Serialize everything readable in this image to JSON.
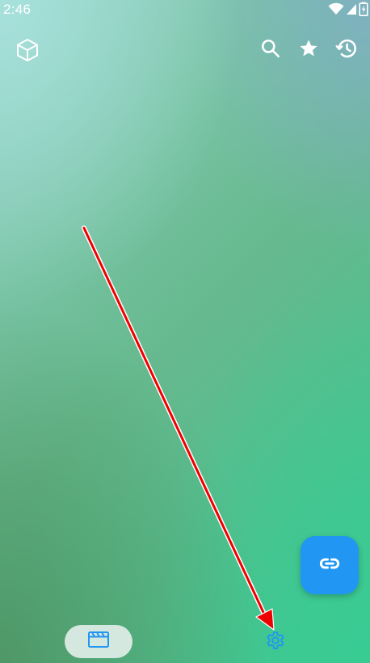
{
  "status_bar": {
    "time": "2:46",
    "icons": [
      "wifi-icon",
      "signal-icon",
      "battery-charging-icon"
    ]
  },
  "top_bar": {
    "logo_icon": "cube-icon",
    "actions": [
      {
        "name": "search",
        "icon": "search-icon"
      },
      {
        "name": "favorites",
        "icon": "star-icon"
      },
      {
        "name": "history",
        "icon": "history-icon"
      }
    ]
  },
  "fab": {
    "icon": "link-icon",
    "color": "#2196f3"
  },
  "bottom_nav": {
    "items": [
      {
        "name": "videos",
        "icon": "clapperboard-icon",
        "selected": true
      },
      {
        "name": "settings",
        "icon": "gear-icon",
        "selected": false
      }
    ],
    "accent": "#2196f3"
  },
  "annotation": {
    "type": "arrow",
    "color": "#ff0000",
    "points_to": "settings"
  }
}
